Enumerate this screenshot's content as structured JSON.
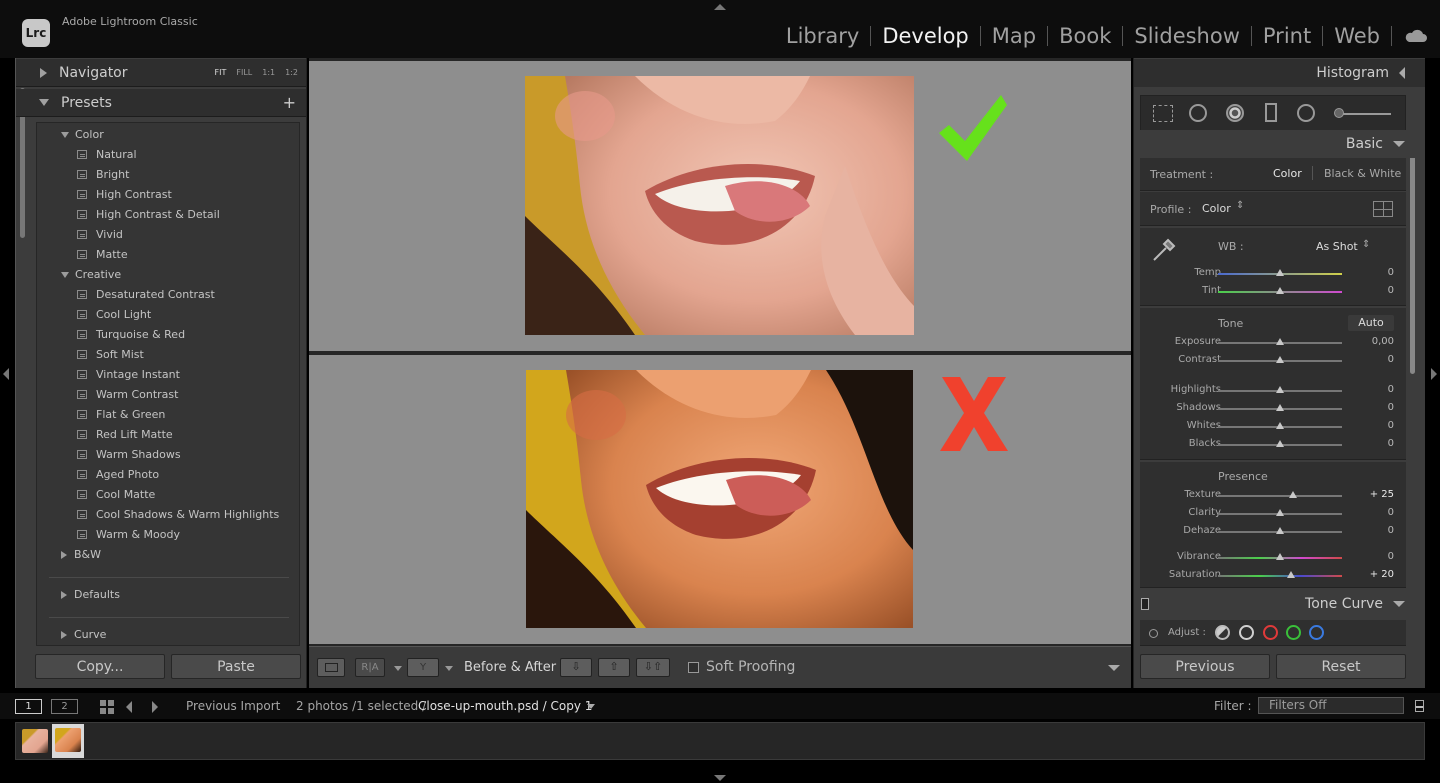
{
  "app": {
    "logo": "Lrc",
    "name": "Adobe Lightroom Classic"
  },
  "modules": [
    {
      "label": "Library",
      "active": false
    },
    {
      "label": "Develop",
      "active": true
    },
    {
      "label": "Map",
      "active": false
    },
    {
      "label": "Book",
      "active": false
    },
    {
      "label": "Slideshow",
      "active": false
    },
    {
      "label": "Print",
      "active": false
    },
    {
      "label": "Web",
      "active": false
    }
  ],
  "left": {
    "navigator": {
      "label": "Navigator",
      "zoom": [
        "FIT",
        "FILL",
        "1:1",
        "1:2"
      ]
    },
    "presets": {
      "label": "Presets",
      "add_icon": "plus-icon"
    },
    "folders": {
      "color": "Color",
      "creative": "Creative",
      "bw": "B&W",
      "defaults": "Defaults",
      "curve": "Curve"
    },
    "color_presets": [
      "Natural",
      "Bright",
      "High Contrast",
      "High Contrast & Detail",
      "Vivid",
      "Matte"
    ],
    "creative_presets": [
      "Desaturated Contrast",
      "Cool Light",
      "Turquoise & Red",
      "Soft Mist",
      "Vintage Instant",
      "Warm Contrast",
      "Flat & Green",
      "Red Lift Matte",
      "Warm Shadows",
      "Aged Photo",
      "Cool Matte",
      "Cool Shadows & Warm Highlights",
      "Warm & Moody"
    ],
    "copy": "Copy...",
    "paste": "Paste"
  },
  "center": {
    "before_after": "Before & After :",
    "soft_proofing": "Soft Proofing",
    "top_mark": "checkmark-icon",
    "bottom_mark": "x-mark-icon",
    "colors": {
      "check": "#66e11b",
      "cross": "#f0412d",
      "view_bg": "#8e8e8e"
    }
  },
  "right": {
    "histogram": "Histogram",
    "basic": "Basic",
    "treatment_label": "Treatment :",
    "treatment_color": "Color",
    "treatment_bw": "Black & White",
    "profile_label": "Profile :",
    "profile_value": "Color",
    "wb_label": "WB :",
    "wb_value": "As Shot",
    "tone_label": "Tone",
    "auto": "Auto",
    "presence_label": "Presence",
    "sliders": {
      "temp": {
        "label": "Temp",
        "value": "0"
      },
      "tint": {
        "label": "Tint",
        "value": "0"
      },
      "exposure": {
        "label": "Exposure",
        "value": "0,00"
      },
      "contrast": {
        "label": "Contrast",
        "value": "0"
      },
      "highlights": {
        "label": "Highlights",
        "value": "0"
      },
      "shadows": {
        "label": "Shadows",
        "value": "0"
      },
      "whites": {
        "label": "Whites",
        "value": "0"
      },
      "blacks": {
        "label": "Blacks",
        "value": "0"
      },
      "texture": {
        "label": "Texture",
        "value": "+ 25"
      },
      "clarity": {
        "label": "Clarity",
        "value": "0"
      },
      "dehaze": {
        "label": "Dehaze",
        "value": "0"
      },
      "vibrance": {
        "label": "Vibrance",
        "value": "0"
      },
      "saturation": {
        "label": "Saturation",
        "value": "+ 20"
      }
    },
    "tone_curve": "Tone Curve",
    "adjust_label": "Adjust :",
    "previous": "Previous",
    "reset": "Reset"
  },
  "filmbar": {
    "screen1": "1",
    "screen2": "2",
    "source": "Previous Import",
    "count": "2 photos /1 selected /",
    "filename": "Close-up-mouth.psd / Copy 1",
    "filter_label": "Filter :",
    "filter_value": "Filters Off"
  }
}
